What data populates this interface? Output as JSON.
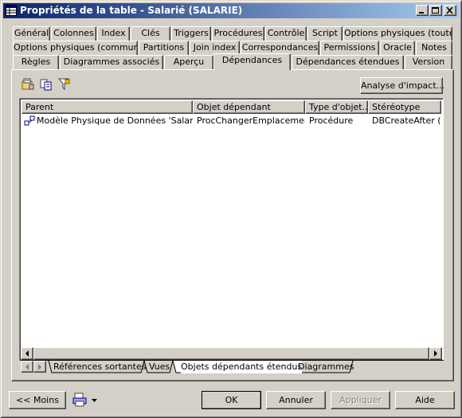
{
  "window": {
    "title": "Propriétés de la table - Salarié (SALARIE)"
  },
  "tabs": {
    "row1": [
      "Général",
      "Colonnes",
      "Index",
      "Clés",
      "Triggers",
      "Procédures",
      "Contrôle",
      "Script",
      "Options physiques (toutes)"
    ],
    "row2": [
      "Options physiques (communes)",
      "Partitions",
      "Join index",
      "Correspondances",
      "Permissions",
      "Oracle",
      "Notes"
    ],
    "row3": [
      "Règles",
      "Diagrammes associés",
      "Aperçu",
      "Dépendances",
      "Dépendances étendues",
      "Version"
    ],
    "active": "Dépendances"
  },
  "toolbar": {
    "analyse_label": "Analyse d'impact..."
  },
  "list": {
    "columns": [
      "Parent",
      "Objet dépendant",
      "Type d'objet...",
      "Stéréotype"
    ],
    "rows": [
      {
        "parent": "Modèle Physique de Données 'Salariés'",
        "objet": "ProcChangerEmplacement",
        "type": "Procédure",
        "stereotype": "DBCreateAfter (..."
      }
    ]
  },
  "bottom_tabs": [
    "Références sortantes",
    "Vues",
    "Objets dépendants étendus",
    "Diagrammes"
  ],
  "bottom_tabs_active": "Objets dépendants étendus",
  "buttons": {
    "moins": "<< Moins",
    "ok": "OK",
    "annuler": "Annuler",
    "appliquer": "Appliquer",
    "aide": "Aide"
  },
  "colors": {
    "titlebar_start": "#0a246a",
    "titlebar_end": "#a6caf0",
    "face": "#d4d0c8"
  }
}
